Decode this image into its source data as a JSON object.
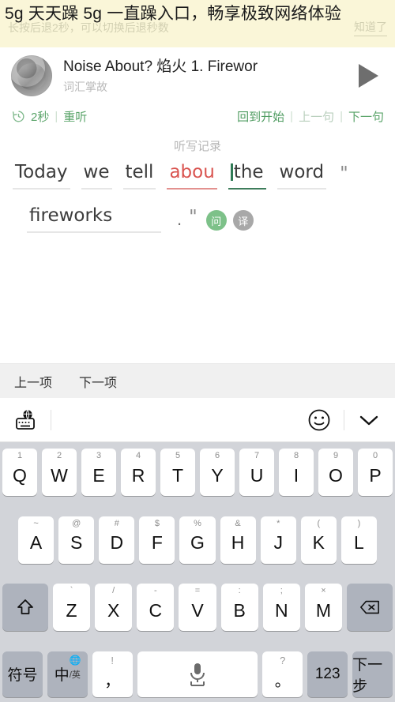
{
  "ad": {
    "text": "5g 天天躁 5g 一直躁入口，畅享极致网络体验",
    "ghost_tip": "长按后退2秒，可以切换后退秒数",
    "ghost_dismiss": "知道了"
  },
  "player": {
    "title": "Noise About? 焰火    1. Firewor",
    "subtitle": "词汇掌故",
    "play_icon": "play-icon"
  },
  "controls": {
    "rewind_seconds": "2秒",
    "replay": "重听",
    "back_to_start": "回到开始",
    "prev_sentence": "上一句",
    "next_sentence": "下一句",
    "separator": "|",
    "green": "#5aa469",
    "dim_green": "#b9cfbd"
  },
  "dictation": {
    "label": "听写记录",
    "line1": [
      {
        "text": "Today",
        "state": "normal"
      },
      {
        "text": "we",
        "state": "normal"
      },
      {
        "text": "tell",
        "state": "normal"
      },
      {
        "text": "abou",
        "state": "error"
      },
      {
        "text": "the",
        "state": "active"
      },
      {
        "text": "word",
        "state": "normal"
      },
      {
        "text": "\"",
        "state": "quote"
      }
    ],
    "line2_word": "fireworks",
    "line2_period": ".",
    "line2_quote": "\"",
    "ask_button": "问",
    "translate_button": "译",
    "error_color": "#d9534f",
    "active_color": "#2f7a55"
  },
  "itembar": {
    "prev": "上一项",
    "next": "下一项"
  },
  "keyboard_bar": {
    "globe_keyboard_icon": "globe-keyboard-icon",
    "emoji_icon": "smiley-icon",
    "collapse_icon": "chevron-down-icon"
  },
  "keyboard": {
    "row1": [
      {
        "hint": "1",
        "main": "Q"
      },
      {
        "hint": "2",
        "main": "W"
      },
      {
        "hint": "3",
        "main": "E"
      },
      {
        "hint": "4",
        "main": "R"
      },
      {
        "hint": "5",
        "main": "T"
      },
      {
        "hint": "6",
        "main": "Y"
      },
      {
        "hint": "7",
        "main": "U"
      },
      {
        "hint": "8",
        "main": "I"
      },
      {
        "hint": "9",
        "main": "O"
      },
      {
        "hint": "0",
        "main": "P"
      }
    ],
    "row2": [
      {
        "hint": "~",
        "main": "A"
      },
      {
        "hint": "@",
        "main": "S"
      },
      {
        "hint": "#",
        "main": "D"
      },
      {
        "hint": "$",
        "main": "F"
      },
      {
        "hint": "%",
        "main": "G"
      },
      {
        "hint": "&",
        "main": "H"
      },
      {
        "hint": "*",
        "main": "J"
      },
      {
        "hint": "(",
        "main": "K"
      },
      {
        "hint": ")",
        "main": "L"
      }
    ],
    "row3": [
      {
        "hint": "`",
        "main": "Z"
      },
      {
        "hint": "/",
        "main": "X"
      },
      {
        "hint": "-",
        "main": "C"
      },
      {
        "hint": "=",
        "main": "V"
      },
      {
        "hint": ":",
        "main": "B"
      },
      {
        "hint": ";",
        "main": "N"
      },
      {
        "hint": "×",
        "main": "M"
      }
    ],
    "shift_icon": "shift-icon",
    "backspace_icon": "backspace-icon",
    "row4": {
      "symbols": "符号",
      "lang_main": "中",
      "lang_sub": "/英",
      "comma_hint": "!",
      "comma_main": "，",
      "space_icon": "microphone-icon",
      "period_hint": "?",
      "period_main": "。",
      "numbers": "123",
      "next_step": "下一步"
    }
  }
}
